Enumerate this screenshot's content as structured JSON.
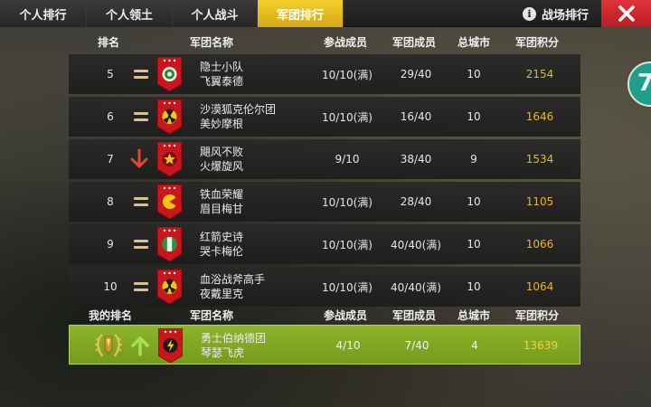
{
  "tabs": [
    {
      "label": "个人排行",
      "active": false
    },
    {
      "label": "个人领土",
      "active": false
    },
    {
      "label": "个人战斗",
      "active": false
    },
    {
      "label": "军团排行",
      "active": true
    }
  ],
  "info": {
    "icon": "i",
    "label": "战场排行"
  },
  "close_icon": "close-x-icon",
  "columns": {
    "rank": "排名",
    "legion_name": "军团名称",
    "participants": "参战成员",
    "members": "军团成员",
    "cities": "总城市",
    "score": "军团积分"
  },
  "rows": [
    {
      "rank": "5",
      "trend": "same",
      "emblem": "target",
      "line1": "隐士小队",
      "line2": "飞翼泰德",
      "participants": "10/10(满)",
      "members": "29/40",
      "cities": "10",
      "score": "2154"
    },
    {
      "rank": "6",
      "trend": "same",
      "emblem": "radiation",
      "line1": "沙漠狐克伦尔团",
      "line2": "美妙摩根",
      "participants": "10/10(满)",
      "members": "16/40",
      "cities": "10",
      "score": "1646"
    },
    {
      "rank": "7",
      "trend": "down",
      "emblem": "star",
      "line1": "飓风不败",
      "line2": "火爆旋风",
      "participants": "9/10",
      "members": "38/40",
      "cities": "9",
      "score": "1534"
    },
    {
      "rank": "8",
      "trend": "same",
      "emblem": "pacman",
      "line1": "铁血荣耀",
      "line2": "眉目梅甘",
      "participants": "10/10(满)",
      "members": "28/40",
      "cities": "10",
      "score": "1105"
    },
    {
      "rank": "9",
      "trend": "same",
      "emblem": "flag",
      "line1": "红箭史诗",
      "line2": "哭卡梅伦",
      "participants": "10/10(满)",
      "members": "40/40(满)",
      "cities": "10",
      "score": "1066"
    },
    {
      "rank": "10",
      "trend": "same",
      "emblem": "radiation",
      "line1": "血浴战斧高手",
      "line2": "夜戴里克",
      "participants": "10/10(满)",
      "members": "40/40(满)",
      "cities": "10",
      "score": "1064"
    }
  ],
  "my_columns": {
    "rank": "我的排名",
    "legion_name": "军团名称",
    "participants": "参战成员",
    "members": "军团成员",
    "cities": "总城市",
    "score": "军团积分"
  },
  "my_row": {
    "rank_icon": "laurel-medal-icon",
    "trend": "up",
    "emblem": "lightning",
    "line1": "勇士伯纳德团",
    "line2": "琴瑟飞虎",
    "participants": "4/10",
    "members": "7/40",
    "cities": "4",
    "score": "13639"
  },
  "colors": {
    "tab_active": "#f2cf2c",
    "close_button": "#d12a32",
    "score_text": "#f0b428",
    "my_row_bg": "#86ad25",
    "trend_up": "#a6e05a",
    "trend_down": "#e0453a",
    "emblem_red": "#c8161c"
  },
  "side_button_glyph": "7"
}
